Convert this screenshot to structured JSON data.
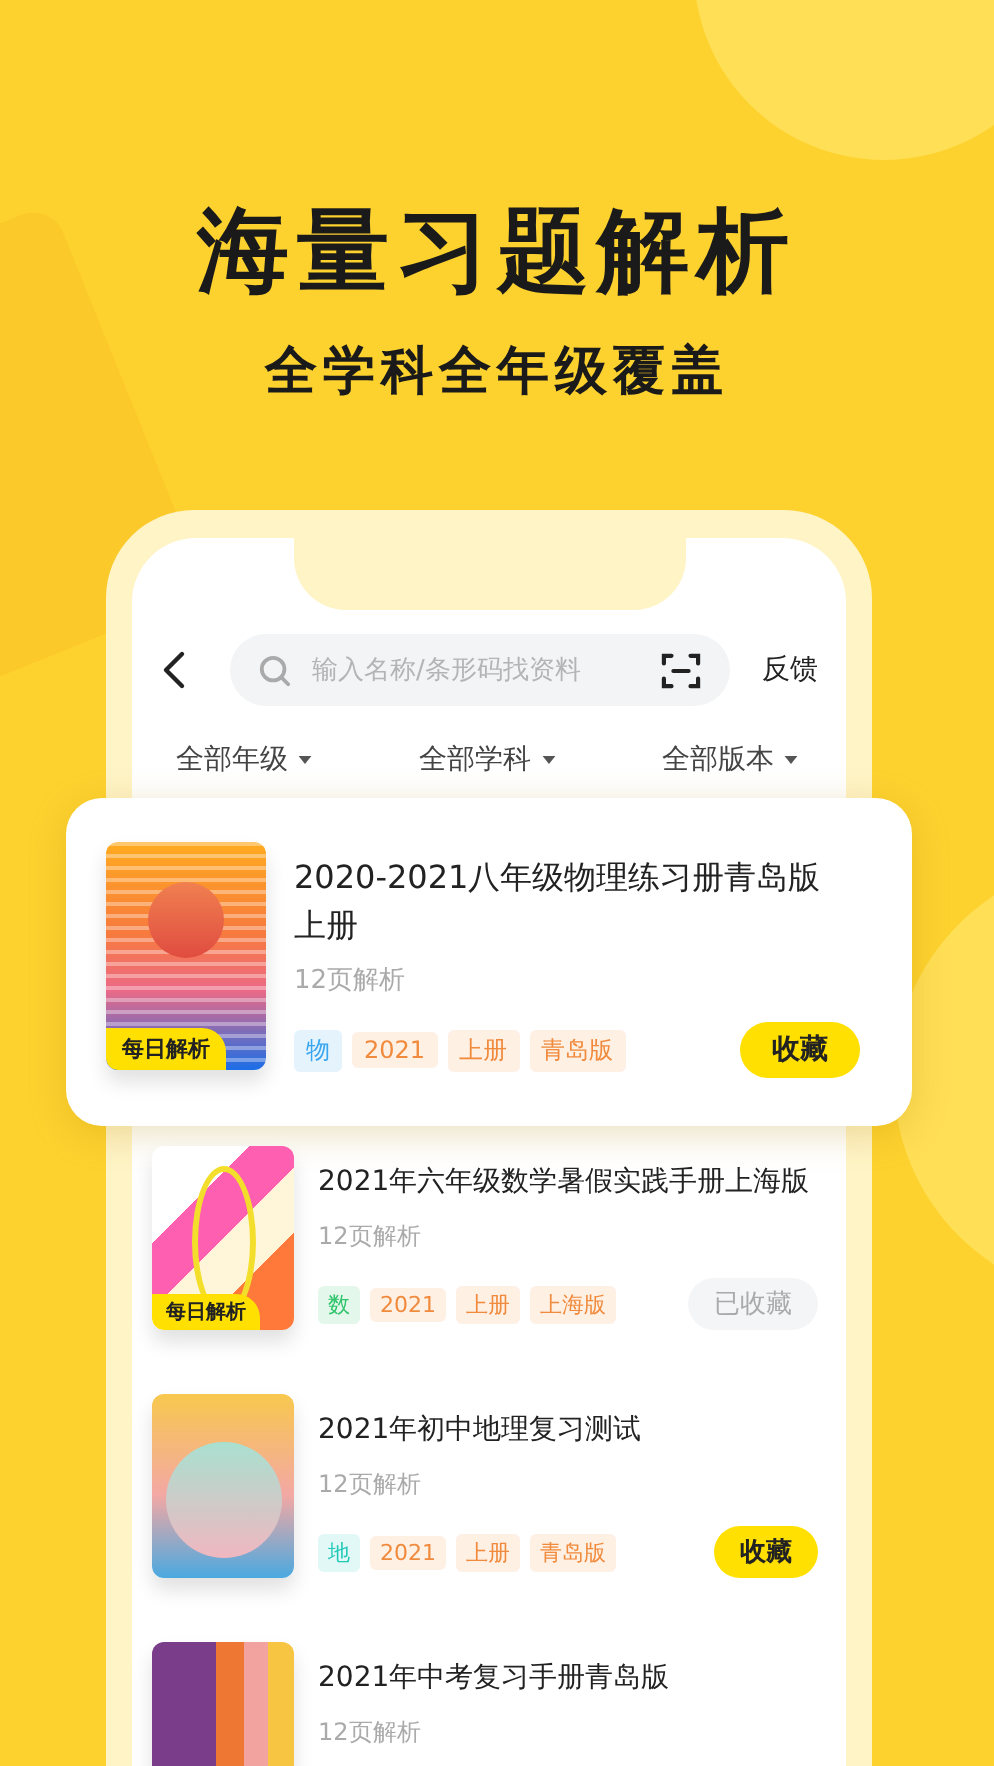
{
  "headline": "海量习题解析",
  "subheadline": "全学科全年级覆盖",
  "nav": {
    "search_placeholder": "输入名称/条形码找资料",
    "feedback": "反馈"
  },
  "filters": [
    {
      "label": "全部年级"
    },
    {
      "label": "全部学科"
    },
    {
      "label": "全部版本"
    }
  ],
  "books": [
    {
      "featured": true,
      "kind": "sunset-stripes",
      "daily_badge": "每日解析",
      "title": "2020-2021八年级物理练习册青岛版上册",
      "pages": "12页解析",
      "subject": {
        "label": "物",
        "color": "#3aa6f0"
      },
      "tags": [
        "2021",
        "上册",
        "青岛版"
      ],
      "collected": false,
      "button": "收藏"
    },
    {
      "featured": false,
      "kind": "abstract",
      "daily_badge": "每日解析",
      "title": "2021年六年级数学暑假实践手册上海版",
      "pages": "12页解析",
      "subject": {
        "label": "数",
        "color": "#2fc46a"
      },
      "tags": [
        "2021",
        "上册",
        "上海版"
      ],
      "collected": true,
      "button": "已收藏"
    },
    {
      "featured": false,
      "kind": "gradient-circle",
      "title": "2021年初中地理复习测试",
      "pages": "12页解析",
      "subject": {
        "label": "地",
        "color": "#23c9b8"
      },
      "tags": [
        "2021",
        "上册",
        "青岛版"
      ],
      "collected": false,
      "button": "收藏"
    },
    {
      "featured": false,
      "kind": "blocks",
      "title": "2021年中考复习手册青岛版",
      "pages": "12页解析"
    }
  ]
}
